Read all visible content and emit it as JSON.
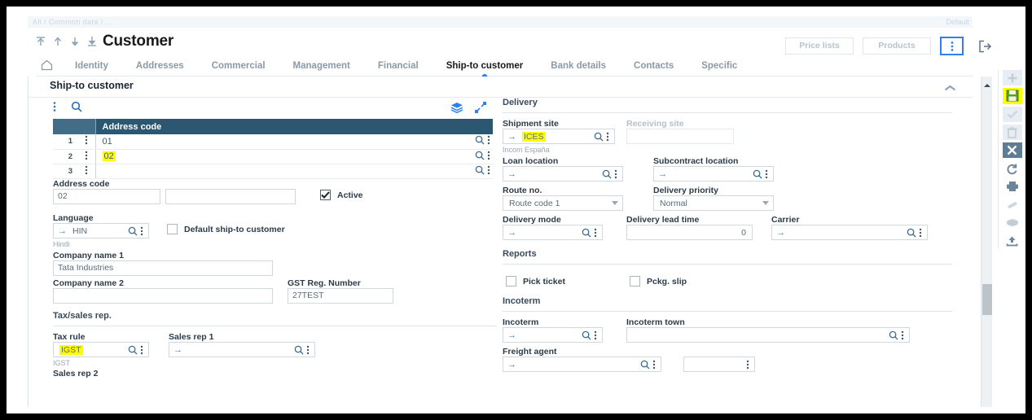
{
  "breadcrumb": {
    "text": "All / Common data / ...",
    "right": "Default"
  },
  "header": {
    "title": "Customer",
    "nav_icons": [
      "first-record",
      "previous-record",
      "next-record",
      "last-record"
    ],
    "buttons": [
      {
        "label": "Price lists",
        "name": "price-lists-button"
      },
      {
        "label": "Products",
        "name": "products-button"
      }
    ],
    "kebab_label": "⋮",
    "logout_icon": "logout-icon"
  },
  "tabs": [
    {
      "label": "",
      "name": "tab-home",
      "icon": "home-icon",
      "active": false
    },
    {
      "label": "Identity",
      "name": "tab-identity",
      "active": false
    },
    {
      "label": "Addresses",
      "name": "tab-addresses",
      "active": false
    },
    {
      "label": "Commercial",
      "name": "tab-commercial",
      "active": false
    },
    {
      "label": "Management",
      "name": "tab-management",
      "active": false
    },
    {
      "label": "Financial",
      "name": "tab-financial",
      "active": false
    },
    {
      "label": "Ship-to customer",
      "name": "tab-ship-to-customer",
      "active": true
    },
    {
      "label": "Bank details",
      "name": "tab-bank-details",
      "active": false
    },
    {
      "label": "Contacts",
      "name": "tab-contacts",
      "active": false
    },
    {
      "label": "Specific",
      "name": "tab-specific",
      "active": false
    }
  ],
  "section": {
    "title": "Ship-to customer",
    "collapse_icon": "chevron-up-icon"
  },
  "grid": {
    "toolbar": {
      "kebab": "⋮",
      "search_icon": "search-icon",
      "layers_icon": "layers-icon",
      "expand_icon": "expand-icon"
    },
    "columns": [
      "",
      "",
      "Address code",
      ""
    ],
    "rows": [
      {
        "num": "1",
        "code": "01",
        "highlighted": false
      },
      {
        "num": "2",
        "code": "02",
        "highlighted": true
      },
      {
        "num": "3",
        "code": "",
        "highlighted": false
      }
    ]
  },
  "left": {
    "address_code_label": "Address code",
    "address_code_value": "02",
    "address_name_value": "",
    "active_label": "Active",
    "active_checked": true,
    "language_label": "Language",
    "language_value": "HIN",
    "language_caption": "Hindi",
    "default_shipto_label": "Default ship-to customer",
    "default_shipto_checked": false,
    "company1_label": "Company name 1",
    "company1_value": "Tata Industries",
    "company2_label": "Company name 2",
    "company2_value": "",
    "gst_label": "GST Reg. Number",
    "gst_value": "27TEST",
    "tax_section_title": "Tax/sales rep.",
    "tax_rule_label": "Tax rule",
    "tax_rule_value": "IGST",
    "tax_rule_caption": "IGST",
    "sales_rep1_label": "Sales rep 1",
    "sales_rep1_value": "",
    "sales_rep2_label": "Sales rep 2"
  },
  "right": {
    "delivery_title": "Delivery",
    "shipment_site_label": "Shipment site",
    "shipment_site_value": "ICES",
    "shipment_site_caption": "Incom España",
    "receiving_site_label": "Receiving site",
    "receiving_site_value": "",
    "loan_location_label": "Loan location",
    "loan_location_value": "",
    "subcontract_location_label": "Subcontract location",
    "subcontract_location_value": "",
    "route_no_label": "Route no.",
    "route_no_value": "Route code 1",
    "delivery_priority_label": "Delivery priority",
    "delivery_priority_value": "Normal",
    "delivery_mode_label": "Delivery mode",
    "delivery_mode_value": "",
    "delivery_lead_time_label": "Delivery lead time",
    "delivery_lead_time_value": "0",
    "carrier_label": "Carrier",
    "carrier_value": "",
    "reports_title": "Reports",
    "pick_ticket_label": "Pick ticket",
    "pick_ticket_checked": false,
    "pckg_slip_label": "Pckg. slip",
    "pckg_slip_checked": false,
    "incoterm_title": "Incoterm",
    "incoterm_label": "Incoterm",
    "incoterm_value": "",
    "incoterm_town_label": "Incoterm town",
    "incoterm_town_value": "",
    "freight_agent_label": "Freight agent",
    "freight_agent_value": "",
    "freight_agent_extra_value": ""
  },
  "toolbar_right": [
    {
      "name": "add-icon",
      "style": "box"
    },
    {
      "name": "save-icon",
      "style": "highlight"
    },
    {
      "name": "confirm-icon",
      "style": "box"
    },
    {
      "name": "delete-icon",
      "style": "box"
    },
    {
      "name": "cancel-icon",
      "style": "dark"
    },
    {
      "name": "refresh-icon",
      "style": "plain"
    },
    {
      "name": "print-icon",
      "style": "plain"
    },
    {
      "name": "attach-icon",
      "style": "plain"
    },
    {
      "name": "comment-icon",
      "style": "plain"
    },
    {
      "name": "export-icon",
      "style": "plain"
    }
  ],
  "scrollbar": {
    "up_icon": "scroll-up-icon"
  },
  "colors": {
    "accent": "#2f80ed",
    "grid_header": "#2b5770",
    "highlight": "#ffff00",
    "save_green": "#5a9e24"
  }
}
